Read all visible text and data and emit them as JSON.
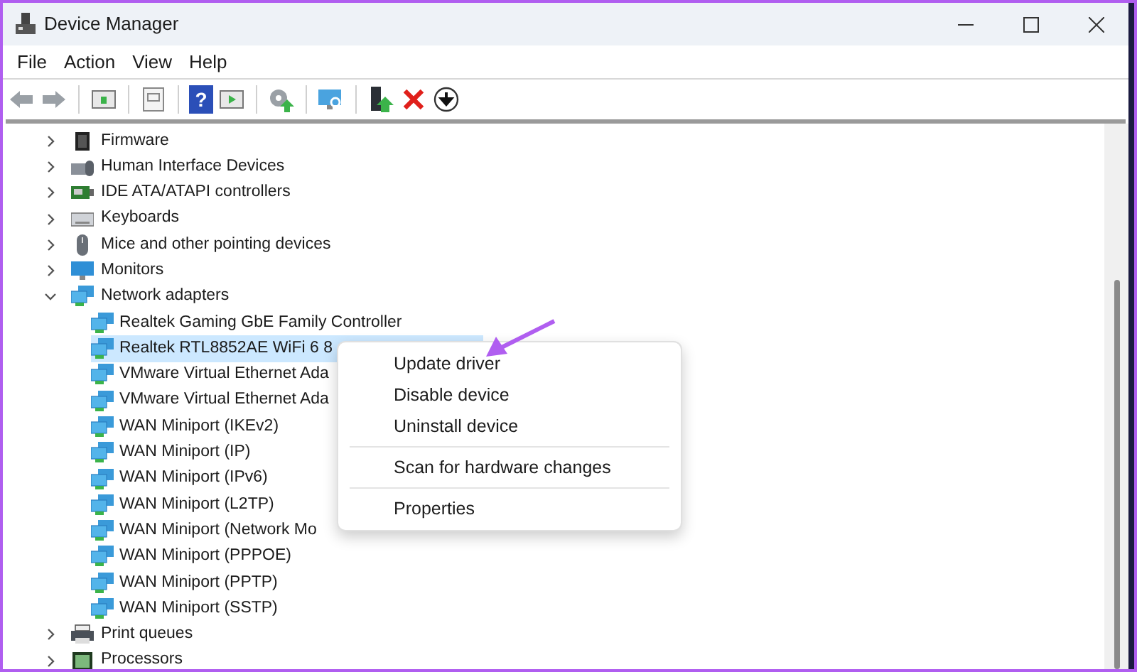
{
  "window": {
    "title": "Device Manager"
  },
  "menu_bar": [
    "File",
    "Action",
    "View",
    "Help"
  ],
  "toolbar": [
    {
      "kind": "back"
    },
    {
      "kind": "forward"
    },
    {
      "kind": "sep"
    },
    {
      "kind": "panel"
    },
    {
      "kind": "sep"
    },
    {
      "kind": "sheet"
    },
    {
      "kind": "sep"
    },
    {
      "kind": "help",
      "label": "?"
    },
    {
      "kind": "panel2"
    },
    {
      "kind": "sep"
    },
    {
      "kind": "gear"
    },
    {
      "kind": "sep"
    },
    {
      "kind": "scan"
    },
    {
      "kind": "sep"
    },
    {
      "kind": "driver"
    },
    {
      "kind": "remove"
    },
    {
      "kind": "down"
    }
  ],
  "tree": [
    {
      "label": "Firmware",
      "kind": "firmware",
      "expanded": false
    },
    {
      "label": "Human Interface Devices",
      "kind": "hid",
      "expanded": false
    },
    {
      "label": "IDE ATA/ATAPI controllers",
      "kind": "ide",
      "expanded": false
    },
    {
      "label": "Keyboards",
      "kind": "keyboard",
      "expanded": false
    },
    {
      "label": "Mice and other pointing devices",
      "kind": "mouse",
      "expanded": false
    },
    {
      "label": "Monitors",
      "kind": "monitor",
      "expanded": false
    },
    {
      "label": "Network adapters",
      "kind": "network",
      "expanded": true,
      "children": [
        {
          "label": "Realtek Gaming GbE Family Controller",
          "selected": false
        },
        {
          "label": "Realtek RTL8852AE WiFi 6 8",
          "selected": true
        },
        {
          "label": "VMware Virtual Ethernet Ada",
          "selected": false
        },
        {
          "label": "VMware Virtual Ethernet Ada",
          "selected": false
        },
        {
          "label": "WAN Miniport (IKEv2)",
          "selected": false
        },
        {
          "label": "WAN Miniport (IP)",
          "selected": false
        },
        {
          "label": "WAN Miniport (IPv6)",
          "selected": false
        },
        {
          "label": "WAN Miniport (L2TP)",
          "selected": false
        },
        {
          "label": "WAN Miniport (Network Mo",
          "selected": false
        },
        {
          "label": "WAN Miniport (PPPOE)",
          "selected": false
        },
        {
          "label": "WAN Miniport (PPTP)",
          "selected": false
        },
        {
          "label": "WAN Miniport (SSTP)",
          "selected": false
        }
      ]
    },
    {
      "label": "Print queues",
      "kind": "printer",
      "expanded": false
    },
    {
      "label": "Processors",
      "kind": "processor",
      "expanded": false
    }
  ],
  "context_menu": {
    "groups": [
      [
        "Update driver",
        "Disable device",
        "Uninstall device"
      ],
      [
        "Scan for hardware changes"
      ],
      [
        "Properties"
      ]
    ]
  }
}
